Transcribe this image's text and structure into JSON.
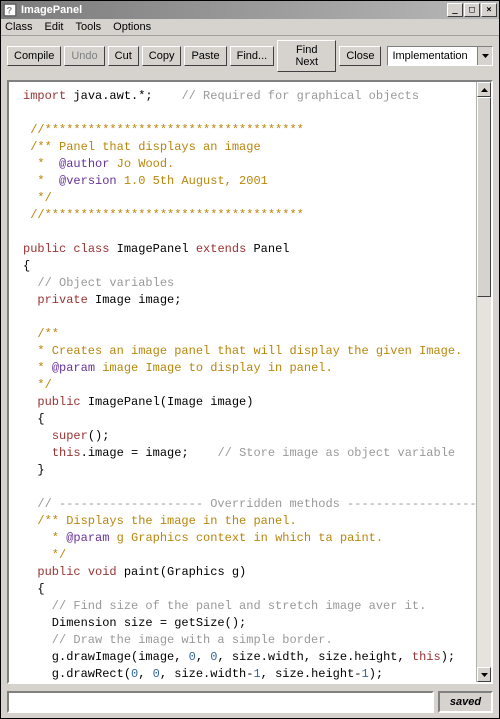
{
  "window": {
    "title": "ImagePanel"
  },
  "menubar": {
    "items": [
      "Class",
      "Edit",
      "Tools",
      "Options"
    ]
  },
  "toolbar": {
    "compile": "Compile",
    "undo": "Undo",
    "cut": "Cut",
    "copy": "Copy",
    "paste": "Paste",
    "find": "Find...",
    "find_next": "Find Next",
    "close": "Close",
    "dropdown_selected": "Implementation"
  },
  "status": {
    "saved": "saved"
  },
  "code": {
    "l01a": "import",
    "l01b": " java.awt.*;",
    "l01c": "    // Required for graphical objects",
    "l02": "",
    "l03": " //************************************",
    "l04": " /** Panel that displays an image",
    "l05a": "  *  ",
    "l05b": "@author",
    "l05c": " Jo Wood.",
    "l06a": "  *  ",
    "l06b": "@version",
    "l06c": " 1.0 5th August, 2001",
    "l07": "  */",
    "l08": " //************************************",
    "l09": "",
    "l10a": "public",
    "l10b": " ",
    "l10c": "class",
    "l10d": " ImagePanel ",
    "l10e": "extends",
    "l10f": " Panel",
    "l11": "{",
    "l12": "  // Object variables",
    "l13a": "  ",
    "l13b": "private",
    "l13c": " Image image;",
    "l14": "",
    "l15": "  /**",
    "l16": "  * Creates an image panel that will display the given Image.",
    "l17a": "  * ",
    "l17b": "@param",
    "l17c": " image Image to display in panel.",
    "l18": "  */",
    "l19a": "  ",
    "l19b": "public",
    "l19c": " ImagePanel(Image image)",
    "l20": "  {",
    "l21a": "    ",
    "l21b": "super",
    "l21c": "();",
    "l22a": "    ",
    "l22b": "this",
    "l22c": ".image = image;",
    "l22d": "    // Store image as object variable",
    "l23": "  }",
    "l24": "",
    "l25": "  // -------------------- Overridden methods --------------------",
    "l26": "  /** Displays the image in the panel.",
    "l27a": "    * ",
    "l27b": "@param",
    "l27c": " g Graphics context in which ta paint.",
    "l28": "    */",
    "l29a": "  ",
    "l29b": "public",
    "l29c": " ",
    "l29d": "void",
    "l29e": " paint(Graphics g)",
    "l30": "  {",
    "l31": "    // Find size of the panel and stretch image aver it.",
    "l32": "    Dimension size = getSize();",
    "l33": "    // Draw the image with a simple border.",
    "l34a": "    g.drawImage(image, ",
    "l34b": "0",
    "l34c": ", ",
    "l34d": "0",
    "l34e": ", size.width, size.height, ",
    "l34f": "this",
    "l34g": ");",
    "l35a": "    g.drawRect(",
    "l35b": "0",
    "l35c": ", ",
    "l35d": "0",
    "l35e": ", size.width-",
    "l35f": "1",
    "l35g": ", size.height-",
    "l35h": "1",
    "l35i": ");",
    "l36": "  }"
  }
}
